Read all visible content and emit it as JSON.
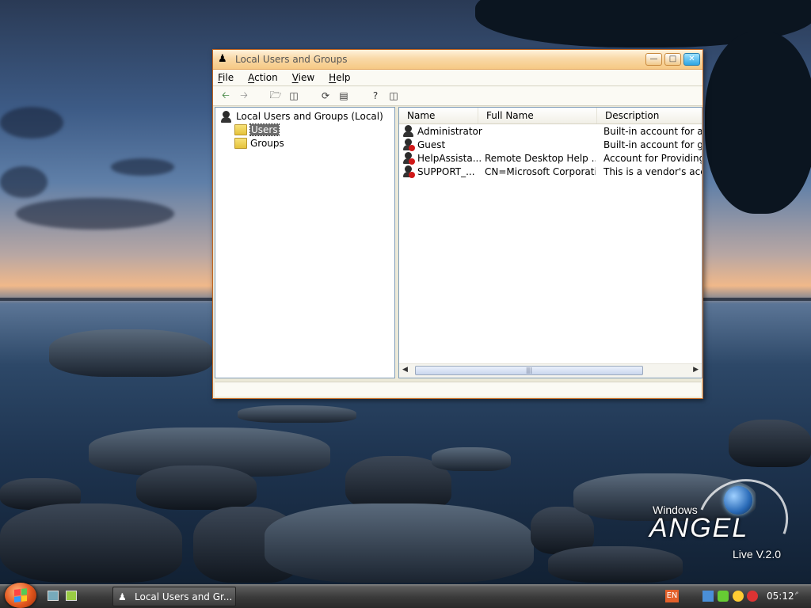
{
  "window": {
    "title": "Local Users and Groups",
    "menu": [
      "File",
      "Action",
      "View",
      "Help"
    ]
  },
  "toolbar": {
    "icons": [
      "back-arrow-icon",
      "forward-arrow-icon",
      "up-folder-icon",
      "show-hide-tree-icon",
      "refresh-icon",
      "export-list-icon",
      "help-icon",
      "action-pane-icon"
    ]
  },
  "tree": {
    "root": "Local Users and Groups (Local)",
    "children": [
      "Users",
      "Groups"
    ]
  },
  "list": {
    "columns": [
      "Name",
      "Full Name",
      "Description"
    ],
    "rows": [
      {
        "name": "Administrator",
        "full_name": "",
        "description": "Built-in account for adm"
      },
      {
        "name": "Guest",
        "full_name": "",
        "description": "Built-in account for gue"
      },
      {
        "name": "HelpAssista...",
        "full_name": "Remote Desktop Help ...",
        "description": "Account for Providing R"
      },
      {
        "name": "SUPPORT_...",
        "full_name": "CN=Microsoft Corporati...",
        "description": "This is a vendor's acco"
      }
    ]
  },
  "branding": {
    "line1": "Windows",
    "line2": "ANGEL",
    "line3": "Live V.2.0"
  },
  "taskbar": {
    "task_label": "Local Users and Gr...",
    "language": "EN",
    "clock": "05:12",
    "clock_suffix": "م"
  },
  "colors": {
    "title_gradient_top": "#fff3de",
    "title_gradient_bottom": "#f6c984",
    "window_border": "#c1641e",
    "close_button": "#2fa6e2",
    "start_orb": "#e2561d"
  }
}
